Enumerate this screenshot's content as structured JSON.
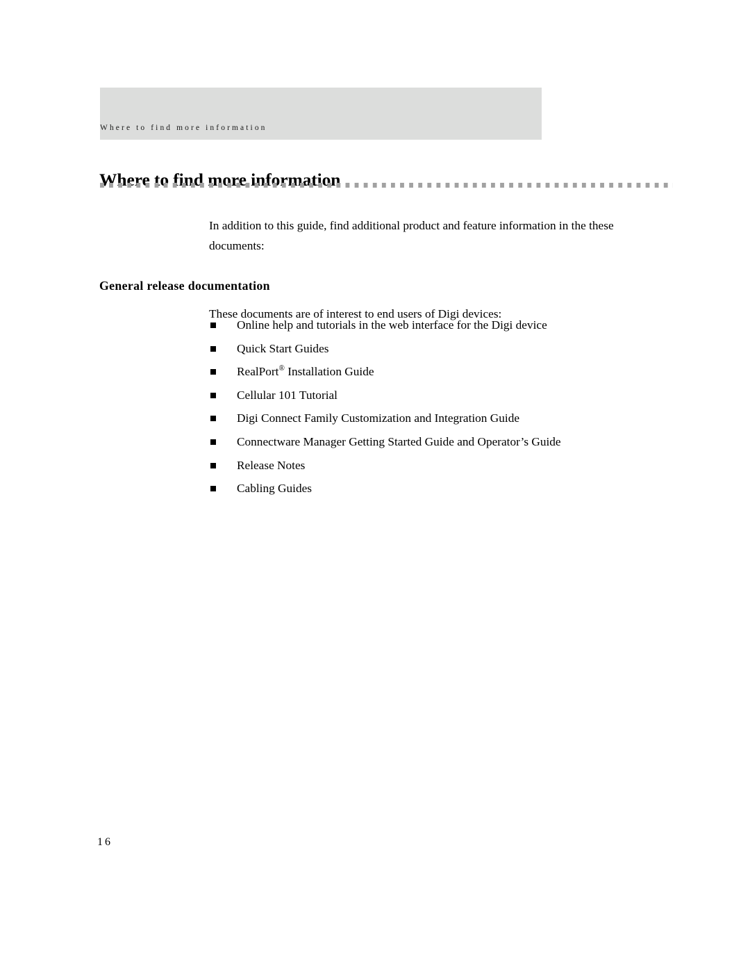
{
  "document": {
    "running_header": "Where to find more information",
    "page_number": "16",
    "colors": {
      "header_band": "#dcdddc",
      "rule_squares": "#a2a2a2",
      "text": "#000000"
    }
  },
  "heading": {
    "title": "Where to find more information"
  },
  "body": {
    "intro_paragraph": "In addition to this guide, find additional product and feature information in the these documents:"
  },
  "section": {
    "title": "General release documentation",
    "intro": "These documents are of interest to end users of Digi devices:",
    "bullets": [
      {
        "text": "Online help and tutorials in the web interface for the Digi device"
      },
      {
        "text": "Quick Start Guides"
      },
      {
        "text_before": "RealPort",
        "superscript": "®",
        "text_after": " Installation Guide"
      },
      {
        "text": "Cellular 101 Tutorial"
      },
      {
        "text": "Digi Connect Family Customization and Integration Guide"
      },
      {
        "text": "Connectware Manager Getting Started Guide and Operator’s Guide"
      },
      {
        "text": "Release Notes"
      },
      {
        "text": "Cabling Guides"
      }
    ]
  }
}
